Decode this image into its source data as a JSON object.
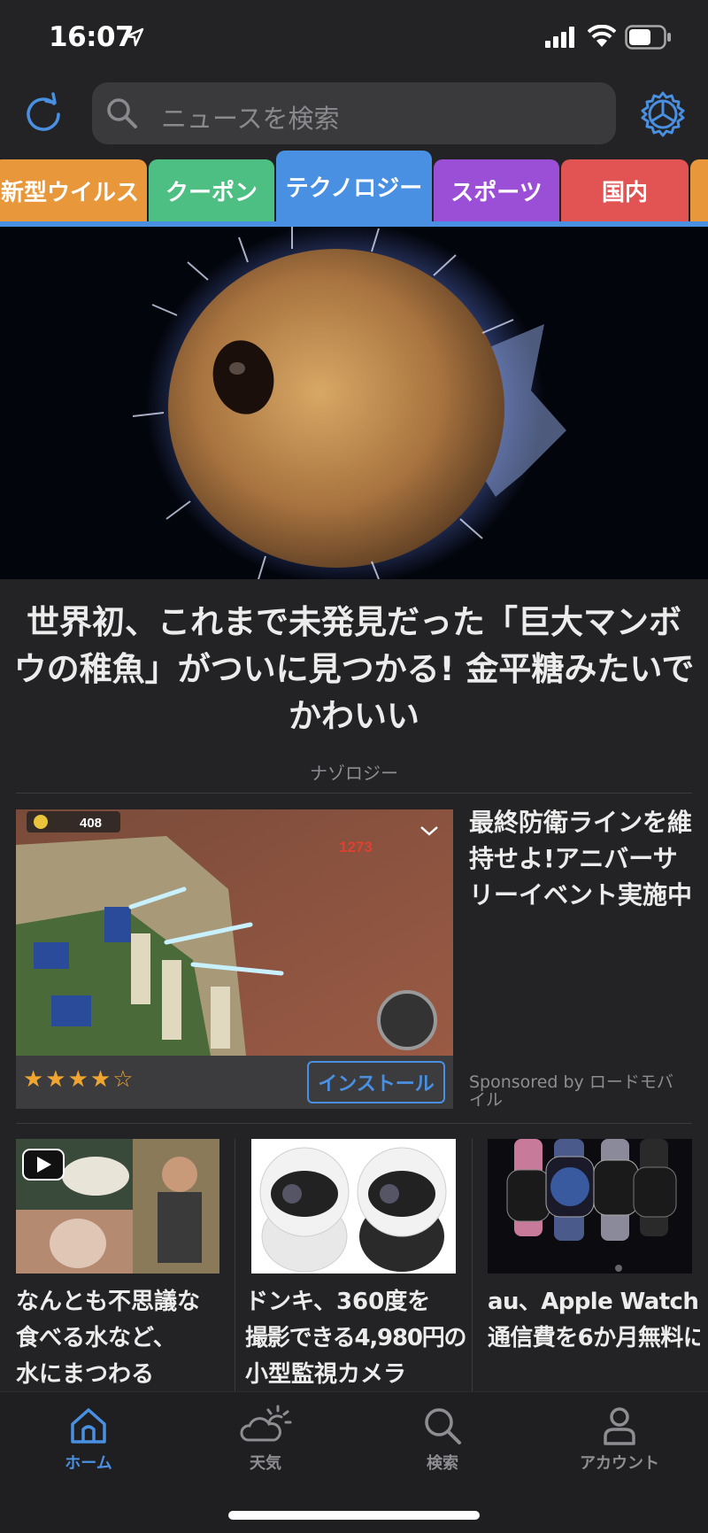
{
  "status_bar": {
    "time": "16:07"
  },
  "search": {
    "placeholder": "ニュースを検索"
  },
  "tabs": [
    {
      "label": "新型ウイルス",
      "color": "#e8973a"
    },
    {
      "label": "クーポン",
      "color": "#4dbf82"
    },
    {
      "label": "テクノロジー",
      "color": "#4a90e2",
      "active": true
    },
    {
      "label": "スポーツ",
      "color": "#9b4fd6"
    },
    {
      "label": "国内",
      "color": "#e25353"
    }
  ],
  "hero": {
    "title": "世界初、これまで未発見だった「巨大マンボウの稚魚」がついに見つかる! 金平糖みたいでかわいい",
    "source": "ナゾロジー"
  },
  "ad": {
    "coins": "408",
    "score": "1273",
    "rating": 4,
    "stars": "★★★★☆",
    "install_label": "インストール",
    "title": "最終防衛ラインを維持せよ!アニバーサリーイベント実施中",
    "sponsor": "Sponsored by ロードモバイル"
  },
  "cards": [
    {
      "title_lines": [
        "なんとも不思議な",
        "食べる水など、",
        "水にまつわる"
      ]
    },
    {
      "title_lines": [
        "ドンキ、360度を",
        "撮影できる4,980円の",
        "小型監視カメラ"
      ]
    },
    {
      "title_lines": [
        "au、Apple Watch の",
        "通信費を6か月無料に"
      ]
    }
  ],
  "nav": [
    {
      "label": "ホーム",
      "icon": "home-icon",
      "active": true
    },
    {
      "label": "天気",
      "icon": "weather-icon"
    },
    {
      "label": "検索",
      "icon": "search-icon"
    },
    {
      "label": "アカウント",
      "icon": "account-icon"
    }
  ],
  "colors": {
    "accent": "#4a90e2",
    "background": "#232325",
    "star": "#f0a530"
  }
}
